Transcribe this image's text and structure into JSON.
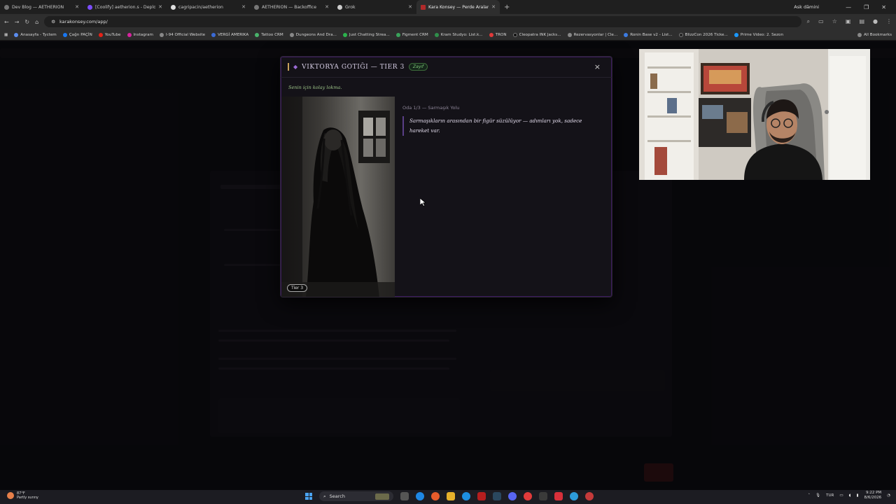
{
  "browser": {
    "tabs": [
      {
        "title": "Dev Blog — AETHERION",
        "active": false
      },
      {
        "title": "[Coolify] aetherion.s - Deploy",
        "active": false
      },
      {
        "title": "cagripacin/aetherion",
        "active": false
      },
      {
        "title": "AETHERION — Backoffice",
        "active": false
      },
      {
        "title": "Grok",
        "active": false
      },
      {
        "title": "Kara Konsey — Perde Aralanıy",
        "active": true
      }
    ],
    "profile_label": "Ask dämini",
    "url": "karakonsey.com/app/",
    "bookmarks": [
      "Anasayfa - Tyctem",
      "Çağrı PAÇİN",
      "YouTube",
      "Instagram",
      "I-94 Official Website",
      "VERGİ AMERIKA",
      "Tattoo CRM",
      "Dungeons And Dra...",
      "Just Chatting Strea...",
      "Figment CRM",
      "Kram Studyo: List.k...",
      "TRON",
      "Cleopatra INK Jacks...",
      "Rezervasyonlar | Cle...",
      "Ronin Base v2 - List...",
      "BlizzCon 2026 Ticke...",
      "Prime Video: 2. Sezon"
    ],
    "all_bookmarks": "All Bookmarks"
  },
  "modal": {
    "title": "VIKTORYA GOTIĞI — TIER 3",
    "badge": "Zayıf",
    "subtitle": "Senin için kolay lokma.",
    "tier_chip": "Tier 3",
    "room_label": "Oda 1/3 — Sarmaşık Yolu",
    "story": "Sarmaşıkların arasından bir figür süzülüyor — adımları yok, sadece hareket var.",
    "close_glyph": "×"
  },
  "taskbar": {
    "weather_temp": "87°F",
    "weather_desc": "Partly sunny",
    "search_placeholder": "Search",
    "lang": "TUR",
    "time": "9:22 PM",
    "date": "8/6/2026"
  }
}
